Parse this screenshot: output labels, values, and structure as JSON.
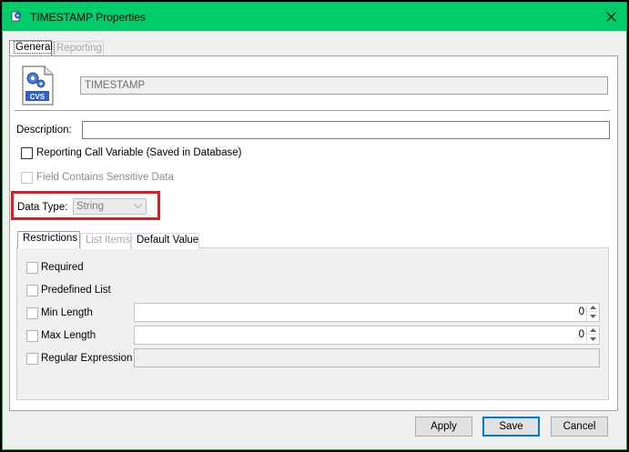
{
  "window": {
    "title": "TIMESTAMP Properties"
  },
  "tabs": [
    {
      "label": "General"
    },
    {
      "label": "Reporting"
    }
  ],
  "general": {
    "name_value": "TIMESTAMP",
    "icon_text": "CVS",
    "description_label": "Description:",
    "description_value": "",
    "reporting_call_variable_label": "Reporting Call Variable (Saved in Database)",
    "sensitive_data_label": "Field Contains Sensitive Data",
    "data_type_label": "Data Type:",
    "data_type_value": "String"
  },
  "inner_tabs": [
    {
      "label": "Restrictions"
    },
    {
      "label": "List Items"
    },
    {
      "label": "Default Value"
    }
  ],
  "restrictions": {
    "required_label": "Required",
    "predefined_list_label": "Predefined List",
    "min_length_label": "Min Length",
    "min_length_value": "0",
    "max_length_label": "Max Length",
    "max_length_value": "0",
    "regex_label": "Regular Expression",
    "regex_value": ""
  },
  "buttons": {
    "apply": "Apply",
    "save": "Save",
    "cancel": "Cancel"
  },
  "colors": {
    "titlebar": "#00cc6a",
    "highlight_box": "#e01b24",
    "default_button_border": "#0078d7"
  },
  "icons": {
    "title": "gear-document-icon",
    "close": "close-icon",
    "field": "cvs-gear-document-icon",
    "dropdown": "chevron-down-icon",
    "spin_up": "spin-up-icon",
    "spin_down": "spin-down-icon"
  }
}
